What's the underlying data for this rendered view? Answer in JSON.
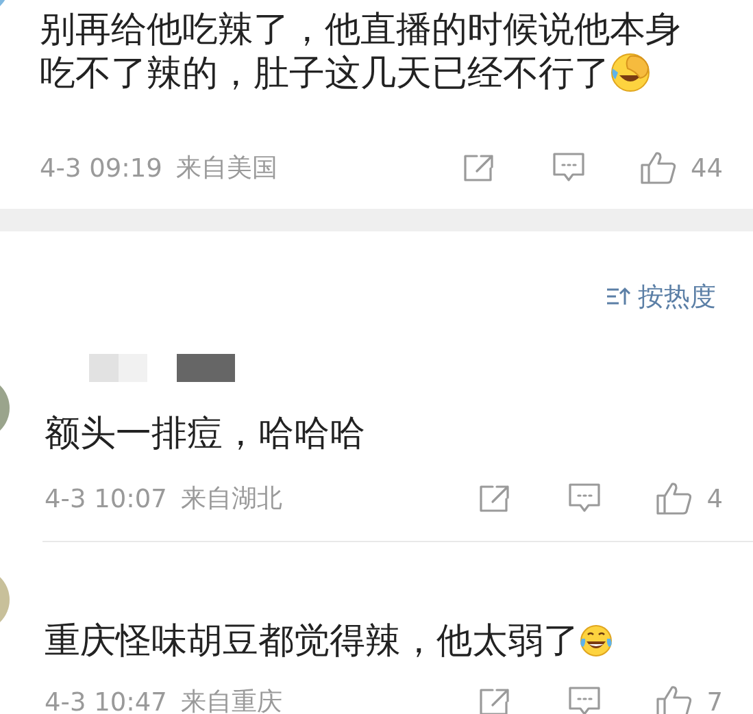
{
  "comments": [
    {
      "name_redacted": false,
      "text": "别再给他吃辣了，他直播的时候说他本身吃不了辣的，肚子这几天已经不行了",
      "kind": "facepalm",
      "time": "4-3 09:19",
      "location": "来自美国",
      "likes": "44"
    },
    {
      "name_redacted": true,
      "text": "额头一排痘，哈哈哈",
      "kind": "plain",
      "time": "4-3 10:07",
      "location": "来自湖北",
      "likes": "4"
    },
    {
      "name_redacted": false,
      "text": "重庆怪味胡豆都觉得辣，他太弱了",
      "kind": "laughing",
      "time": "4-3 10:47",
      "location": "来自重庆",
      "likes": "7"
    }
  ],
  "sort": {
    "label": "按热度"
  }
}
